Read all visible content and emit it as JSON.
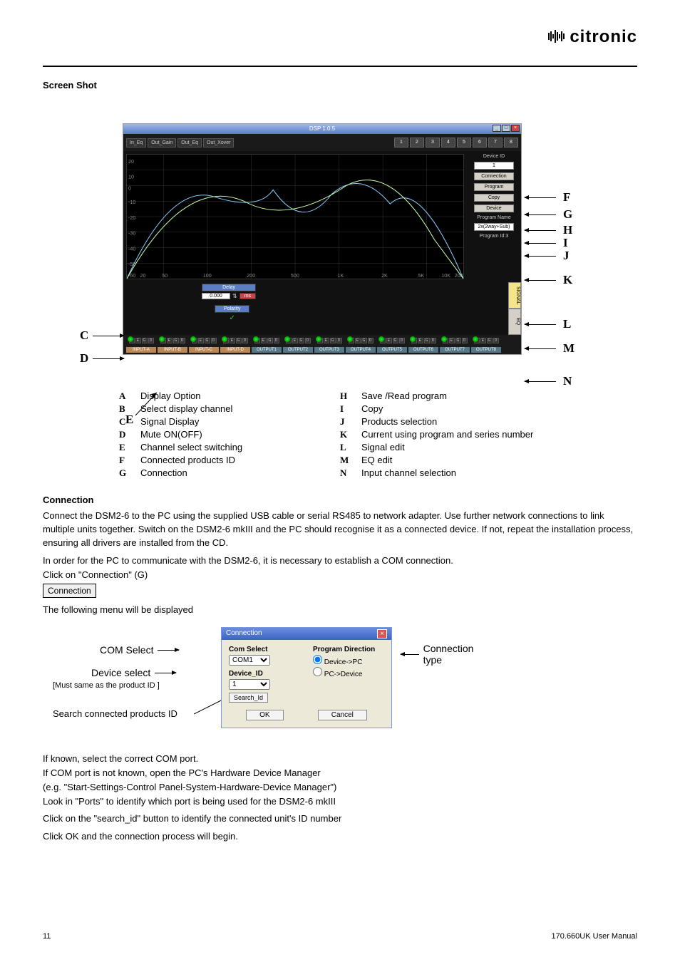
{
  "brand": "citronic",
  "sections": {
    "screenshot_title": "Screen Shot",
    "connection_title": "Connection"
  },
  "dsp": {
    "title": "DSP 1.0.5",
    "toolbar": [
      "In_Eq",
      "Out_Gain",
      "Out_Eq",
      "Out_Xover"
    ],
    "channels": [
      "1",
      "2",
      "3",
      "4",
      "5",
      "6",
      "7",
      "8"
    ],
    "side": {
      "device_id_label": "Device ID",
      "device_id": "1",
      "connection_btn": "Connection",
      "program_btn": "Program",
      "copy_btn": "Copy",
      "device_btn": "Device",
      "program_name_label": "Program Name",
      "program_name": "2x(2way+Sub)",
      "program_id_label": "Program Id:3"
    },
    "delay": {
      "label": "Delay",
      "value": "0.000",
      "unit": "ms"
    },
    "polarity": {
      "label": "Polarity",
      "value": "✓"
    },
    "right_tabs": [
      "SIGNAL",
      "EQ"
    ],
    "modules_in": [
      "InMUTE",
      "InMUTE",
      "InMUTE",
      "InMUTE"
    ],
    "modules_out": [
      "OutMUTE",
      "OutMUTE",
      "OutMUTE",
      "OutMUTE",
      "OutMUTE",
      "OutMUTE",
      "OutMUTE",
      "OutMUTE"
    ],
    "module_names": [
      "INPUT-A",
      "INPUT-B",
      "INPUT-C",
      "INPUT-D",
      "OUTPUT1",
      "OUTPUT2",
      "OUTPUT3",
      "OUTPUT4",
      "OUTPUT5",
      "OUTPUT6",
      "OUTPUT7",
      "OUTPUT8"
    ]
  },
  "pointers": {
    "A": "A",
    "B": "B",
    "C": "C",
    "D": "D",
    "E": "E",
    "F": "F",
    "G": "G",
    "H": "H",
    "I": "I",
    "J": "J",
    "K": "K",
    "L": "L",
    "M": "M",
    "N": "N"
  },
  "legend": {
    "A": "Display Option",
    "B": "Select display channel",
    "C": "Signal Display",
    "D": "Mute ON(OFF)",
    "E": "Channel select switching",
    "F": "Connected products ID",
    "G": "Connection",
    "H": "Save /Read program",
    "I": "Copy",
    "J": "Products selection",
    "K": "Current using program and series number",
    "L": "Signal edit",
    "M": "EQ edit",
    "N": "Input channel selection"
  },
  "connection_text": {
    "p1": "Connect the DSM2-6 to the PC using the supplied USB cable or serial RS485 to network adapter. Use further network connections to link multiple units together. Switch on the DSM2-6 mkIII and the PC should recognise it as a connected device. If not, repeat the installation process, ensuring all drivers are installed from the CD.",
    "p2": "In order for the PC to communicate with the DSM2-6, it is necessary to establish a COM connection.",
    "p3": "Click on \"Connection\" (G)",
    "button": "Connection",
    "p4": "The following menu will be displayed",
    "p5": "If known, select the correct COM port.",
    "p6": "If COM port is not known, open the PC's Hardware Device Manager",
    "p7": "(e.g. \"Start-Settings-Control Panel-System-Hardware-Device Manager\")",
    "p8": "Look in \"Ports\" to identify which port is being used for the DSM2-6 mkIII",
    "p9": "Click on the \"search_id\" button to identify the connected unit's ID number",
    "p10": "Click OK and the connection process will begin."
  },
  "conn_dialog": {
    "title": "Connection",
    "com_select_label": "Com Select",
    "com_value": "COM1",
    "device_id_label": "Device_ID",
    "device_id_value": "1",
    "search_btn": "Search_Id",
    "dir_label": "Program Direction",
    "dir1": "Device->PC",
    "dir2": "PC->Device",
    "ok": "OK",
    "cancel": "Cancel"
  },
  "conn_labels": {
    "com_select": "COM Select",
    "device_select": "Device select",
    "device_select_note": "[Must same as the product ID ]",
    "search_label": "Search connected products ID",
    "conn_type": "Connection type"
  },
  "footer": {
    "page": "11",
    "doc": "170.660UK User Manual"
  }
}
